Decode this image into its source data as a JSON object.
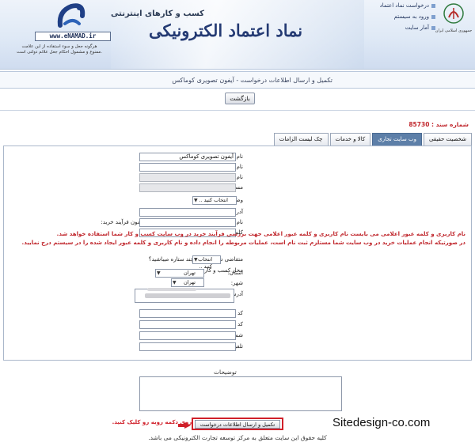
{
  "header": {
    "site_url": "www.eNAMAD.ir",
    "logo_note": "هرگونه جعل و سوء استفاده از این علامت ممنوع و مشمول احکام جعل علائم دولتی است.",
    "slogan": "کسب و کارهای اینترنتی",
    "brand_title": "نماد اعتماد الکترونیکی",
    "top_links": [
      "درخواست نماد اعتماد",
      "ورود به سیستم",
      "آمار سایت"
    ],
    "seal_caption": "جمهوری اسلامی ایران"
  },
  "breadcrumb": "تکمیل و ارسال اطلاعات درخواست - آیفون تصویری کوماکس",
  "back_button": "بازگشت",
  "document_number": "شماره سند : 85730",
  "tabs": [
    {
      "label": "شخصیت حقیقی",
      "active": false
    },
    {
      "label": "وب سایت تجاری",
      "active": true
    },
    {
      "label": "کالا و خدمات",
      "active": false
    },
    {
      "label": "چک لیست الزامات",
      "active": false
    }
  ],
  "form": {
    "business_name_label": "نام کسب و کار:",
    "business_name_value": "آیفون تصویری کوماکس",
    "english_name_label": "نام انگلیسی کسب و کار:",
    "domain_label": "نام دامنه وب سایت (Domain Name):",
    "subpath_label": "مسیر فرعی فروشگاه در وب سایت:",
    "property_status_label": "وضعیت ملک:",
    "property_status_value": "انتخاب کنید ..",
    "email_label": "آدرس پست الکترونیکی ( email ):",
    "test_user_label": "نام کاربری جهت ورود به وب سایت شما و آزمون فرآیند خرید:",
    "test_password_label": "کلمه‌ی عبور مربوط به نام کاربری:",
    "warning_1": "نام کاربری و کلمه عبور اعلامی می بایست نام کاربری و کلمه عبور اعلامی جهت بررسی فرآیند خرید در وب سایت کسب و کار شما استفاده خواهد شد.",
    "warning_2": "در صورتیکه انجام عملیات خرید در وب سایت شما مستلزم ثبت نام است، عملیات مربوطه را انجام داده و نام کاربری و کلمه عبور ایجاد شده را در سیستم درج نمایید.",
    "stars_label": "متقاضی دریافت نماد چند ستاره میباشید؟",
    "stars_value": "انتخاب کنید ..",
    "location_label": "محل کسب و کار:",
    "province_label": "استان:",
    "province_value": "تهران",
    "city_label": "شهر:",
    "city_value": "تهران",
    "address_label": "آدرس:",
    "postal_code_label": "کد پستی ده رقمی (بدون فاصله):",
    "area_code_label": "کد تلفن ثابت:",
    "phone_label": "شماره تلفن ثابت:",
    "mobile_label": "تلفن همراه رابط:"
  },
  "description_label": "توضیحات",
  "submit_button": "تکمیل و ارسال اطلاعات درخواست",
  "submit_hint": "بعد از تکمیل قسمت های بالا بر روی دکمه روبه رو کلیک کنید.",
  "watermark": "Sitedesign-co.com",
  "footer": "کلیه حقوق این سایت متعلق به مرکز توسعه تجارت الکترونیکی می باشد.",
  "colors": {
    "warning": "#c0272d",
    "active_tab": "#5d7fa8",
    "brand": "#243a73"
  }
}
